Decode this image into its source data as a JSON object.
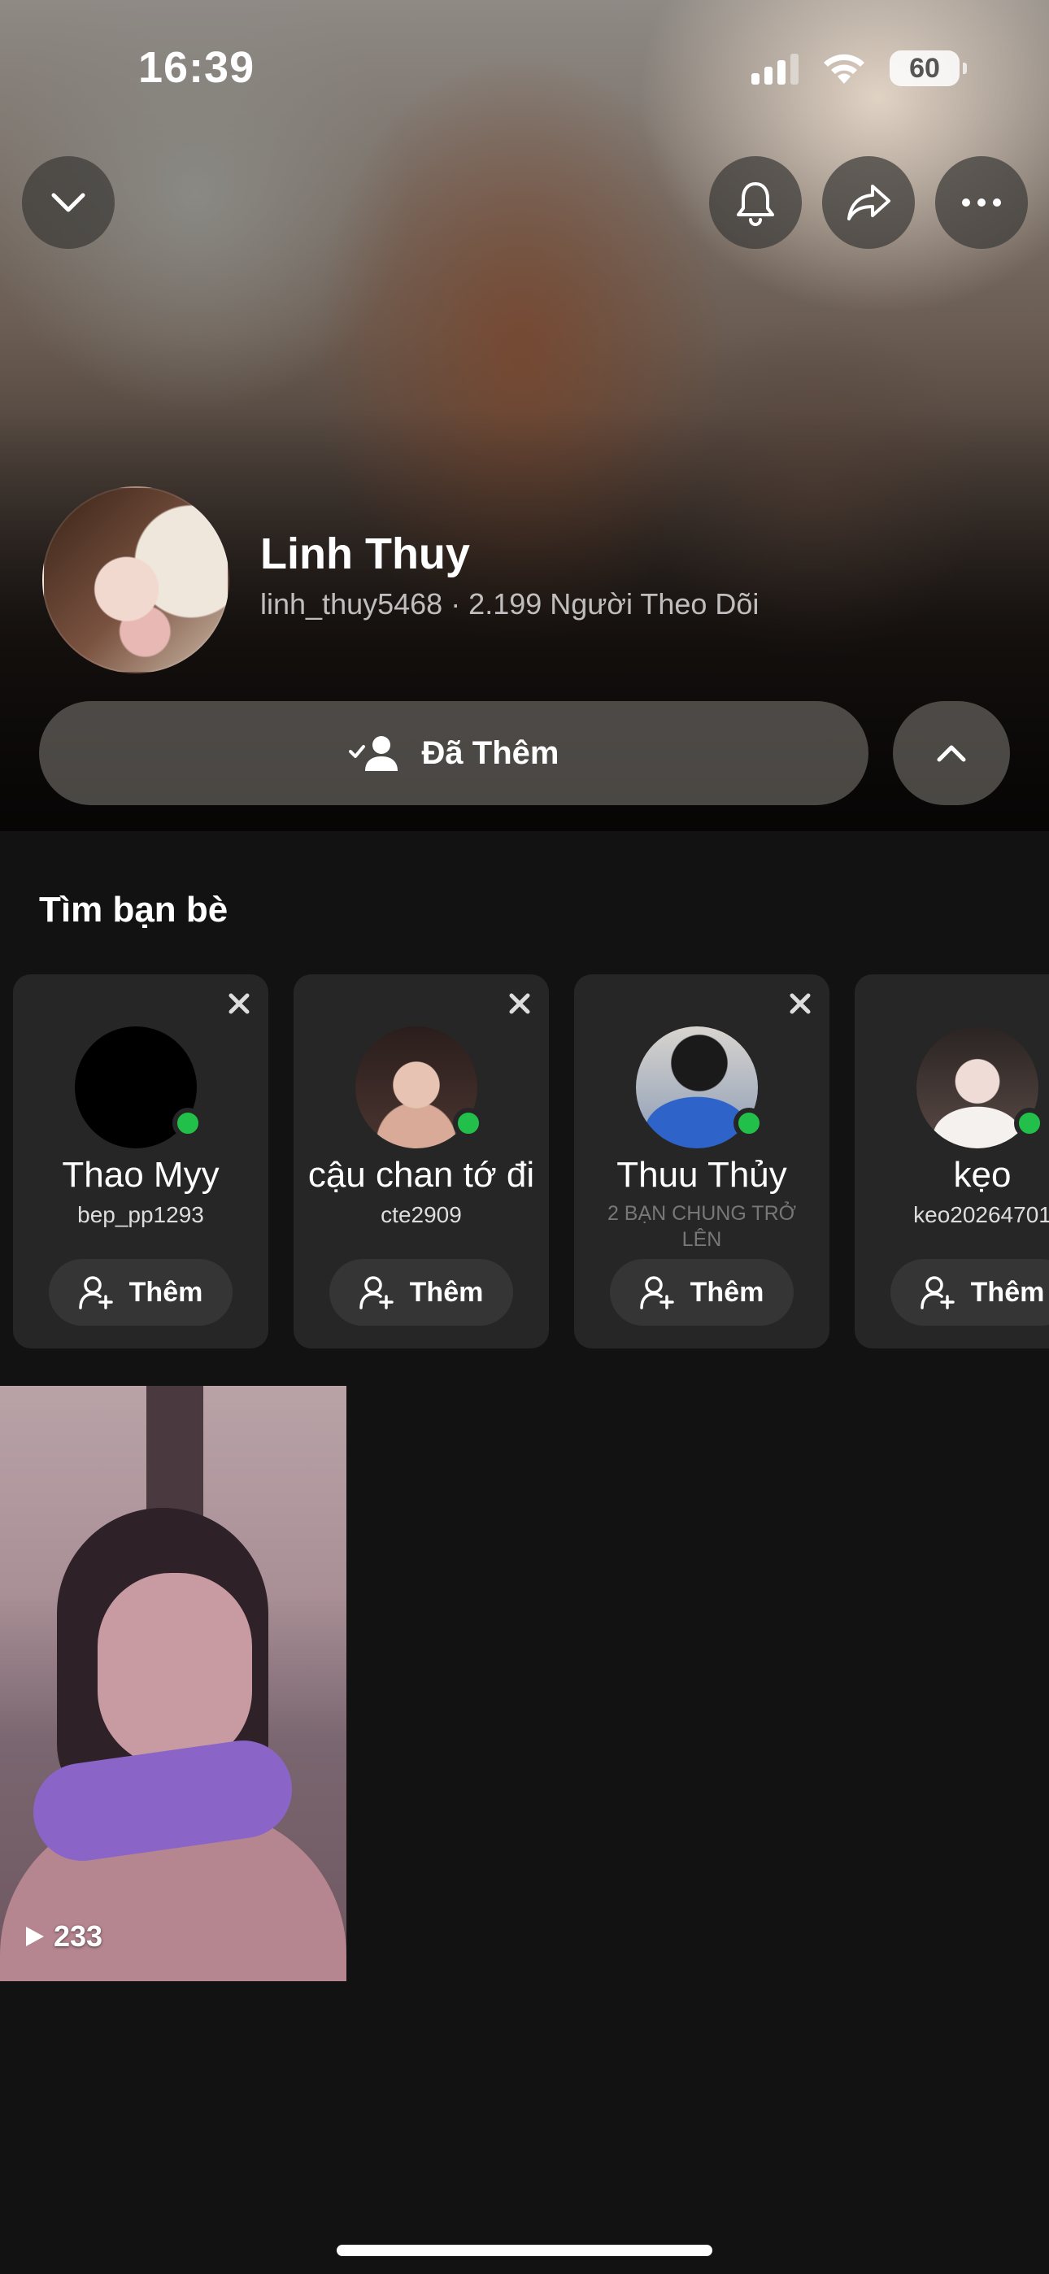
{
  "status": {
    "time": "16:39",
    "battery": "60"
  },
  "profile": {
    "name": "Linh Thuy",
    "subtitle": "linh_thuy5468 · 2.199 Người Theo Dõi",
    "added_label": "Đã Thêm"
  },
  "find_friends": {
    "title": "Tìm bạn bè",
    "cards": [
      {
        "name": "Thao Myy",
        "handle": "bep_pp1293",
        "mutual": "",
        "add_label": "Thêm"
      },
      {
        "name": "cậu chan tớ đi",
        "handle": "cte2909",
        "mutual": "",
        "add_label": "Thêm"
      },
      {
        "name": "Thuu Thủy",
        "handle": "",
        "mutual": "2 BẠN CHUNG TRỞ LÊN",
        "add_label": "Thêm"
      },
      {
        "name": "kẹo",
        "handle": "keo20264701",
        "mutual": "",
        "add_label": "Thêm"
      }
    ]
  },
  "story": {
    "views": "233"
  },
  "icons": {
    "back": "chevron-down-icon",
    "notify": "bell-icon",
    "share": "share-arrow-icon",
    "more": "more-dots-icon",
    "added": "user-check-icon",
    "collapse": "chevron-up-icon",
    "add_friend": "user-plus-icon",
    "dismiss": "close-icon",
    "play": "play-icon"
  },
  "colors": {
    "online": "#22c04a",
    "background": "#121212",
    "card": "#262626"
  }
}
